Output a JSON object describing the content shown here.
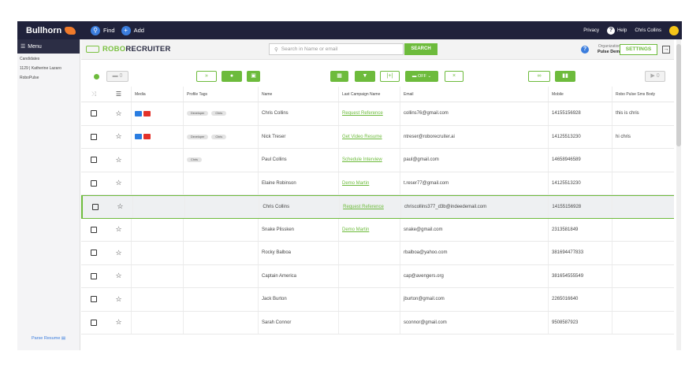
{
  "topbar": {
    "logo": "Bullhorn",
    "find": "Find",
    "add": "Add",
    "privacy": "Privacy",
    "help": "Help",
    "user": "Chris Collins"
  },
  "sidebar": {
    "menu": "Menu",
    "items": [
      "Candidates",
      "1129 | Katherine Lazaro",
      "RoboPulse"
    ],
    "parse": "Parse Resume"
  },
  "header": {
    "brand_a": "ROBO",
    "brand_b": "RECRUITER",
    "search_placeholder": "Search in Name or email",
    "search_button": "SEARCH",
    "org_label": "Organization:",
    "org_name": "Pulse Demo",
    "settings": "SETTINGS"
  },
  "toolbar": {
    "count_left": "0",
    "off_label": "OFF",
    "count_right": "0"
  },
  "columns": [
    "Media",
    "Profile Tags",
    "Name",
    "Last Campaign Name",
    "Email",
    "Mobile",
    "Robo Pulse Sms Body"
  ],
  "rows": [
    {
      "media": true,
      "tags": [
        "Developer",
        "Chris"
      ],
      "name": "Chris Collins",
      "campaign": "Request Reference",
      "email": "collins76@gmail.com",
      "mobile": "14155156928",
      "sms": "this is chris"
    },
    {
      "media": true,
      "tags": [
        "Developer",
        "Chris"
      ],
      "name": "Nick Treser",
      "campaign": "Get Video Resume",
      "email": "ntreser@roborecruiter.ai",
      "mobile": "14125513230",
      "sms": "hi chris"
    },
    {
      "media": false,
      "tags": [
        "Chris"
      ],
      "name": "Paul Collins",
      "campaign": "Schedule Interview",
      "email": "paul@gmail.com",
      "mobile": "14658946589",
      "sms": ""
    },
    {
      "media": false,
      "tags": [],
      "name": "Elaine Robinson",
      "campaign": "Demo Martin",
      "email": "t.reser77@gmail.com",
      "mobile": "14125513230",
      "sms": ""
    },
    {
      "media": false,
      "tags": [],
      "name": "Chris Collins",
      "campaign": "Request Reference",
      "email": "chriscollins377_d3b@indeedemail.com",
      "mobile": "14155156928",
      "sms": "",
      "selected": true
    },
    {
      "media": false,
      "tags": [],
      "name": "Snake Plissken",
      "campaign": "Demo Martin",
      "email": "snake@gmail.com",
      "mobile": "2313581849",
      "sms": ""
    },
    {
      "media": false,
      "tags": [],
      "name": "Rocky Balboa",
      "campaign": "",
      "email": "rbalboa@yahoo.com",
      "mobile": "381694477833",
      "sms": ""
    },
    {
      "media": false,
      "tags": [],
      "name": "Captain America",
      "campaign": "",
      "email": "cap@avengers.org",
      "mobile": "381654555549",
      "sms": ""
    },
    {
      "media": false,
      "tags": [],
      "name": "Jack Burton",
      "campaign": "",
      "email": "jburton@gmail.com",
      "mobile": "2265016640",
      "sms": ""
    },
    {
      "media": false,
      "tags": [],
      "name": "Sarah Connor",
      "campaign": "",
      "email": "sconnor@gmail.com",
      "mobile": "9508587923",
      "sms": ""
    }
  ]
}
